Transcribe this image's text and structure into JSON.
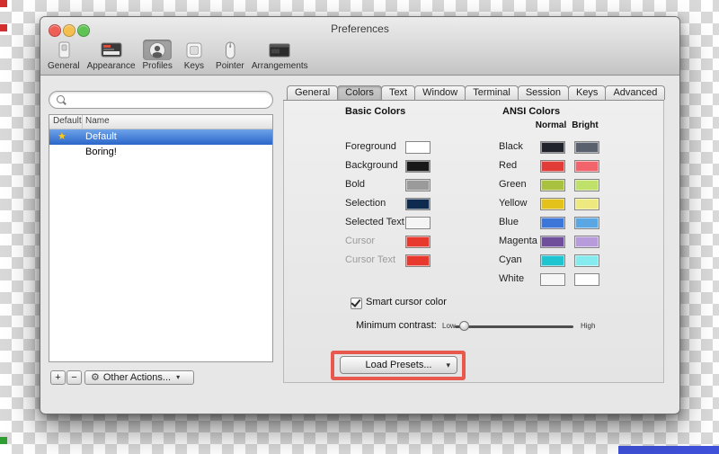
{
  "window": {
    "title": "Preferences",
    "traffic_lights": {
      "close": "#ef5f55",
      "minimize": "#f5bf4f",
      "zoom": "#5fc454"
    }
  },
  "toolbar": {
    "items": [
      {
        "label": "General"
      },
      {
        "label": "Appearance"
      },
      {
        "label": "Profiles"
      },
      {
        "label": "Keys"
      },
      {
        "label": "Pointer"
      },
      {
        "label": "Arrangements"
      }
    ],
    "selected": "Profiles"
  },
  "search": {
    "placeholder": ""
  },
  "profiles_list": {
    "columns": [
      "Default",
      "Name"
    ],
    "rows": [
      {
        "name": "Default",
        "selected": true,
        "is_default": true
      },
      {
        "name": "Boring!",
        "selected": false,
        "is_default": false
      }
    ],
    "add_label": "+",
    "remove_label": "−",
    "other_actions_label": "Other Actions...",
    "gear_glyph": "⚙",
    "caret_glyph": "▾",
    "star_glyph": "★"
  },
  "tabs": {
    "labels": [
      "General",
      "Colors",
      "Text",
      "Window",
      "Terminal",
      "Session",
      "Keys",
      "Advanced"
    ],
    "selected": "Colors"
  },
  "colors_tab": {
    "basic_title": "Basic Colors",
    "ansi_title": "ANSI Colors",
    "normal_header": "Normal",
    "bright_header": "Bright",
    "basic_colors": [
      {
        "label": "Foreground",
        "color": "#ffffff"
      },
      {
        "label": "Background",
        "color": "#181818"
      },
      {
        "label": "Bold",
        "color": "#9a9a9a"
      },
      {
        "label": "Selection",
        "color": "#0e2a4e"
      },
      {
        "label": "Selected Text",
        "color": "#f4f4f4"
      },
      {
        "label": "Cursor",
        "color": "#e8392f",
        "disabled": true
      },
      {
        "label": "Cursor Text",
        "color": "#e8392f",
        "disabled": true
      }
    ],
    "ansi_colors": [
      {
        "label": "Black",
        "normal": "#20232b",
        "bright": "#59606e"
      },
      {
        "label": "Red",
        "normal": "#e23c39",
        "bright": "#f2646c"
      },
      {
        "label": "Green",
        "normal": "#a8c23f",
        "bright": "#bfe069"
      },
      {
        "label": "Yellow",
        "normal": "#e3c21b",
        "bright": "#eee97e"
      },
      {
        "label": "Blue",
        "normal": "#3c76d8",
        "bright": "#5aa7e4"
      },
      {
        "label": "Magenta",
        "normal": "#6f4f9c",
        "bright": "#b79bdb"
      },
      {
        "label": "Cyan",
        "normal": "#1ec4d0",
        "bright": "#86ebee"
      },
      {
        "label": "White",
        "normal": "#f6f6f6",
        "bright": "#ffffff"
      }
    ],
    "smart_cursor": {
      "label": "Smart cursor color",
      "checked": true
    },
    "minimum_contrast": {
      "label": "Minimum contrast:",
      "low": "Low",
      "high": "High"
    },
    "load_presets": {
      "label": "Load Presets...",
      "caret": "▾"
    }
  }
}
